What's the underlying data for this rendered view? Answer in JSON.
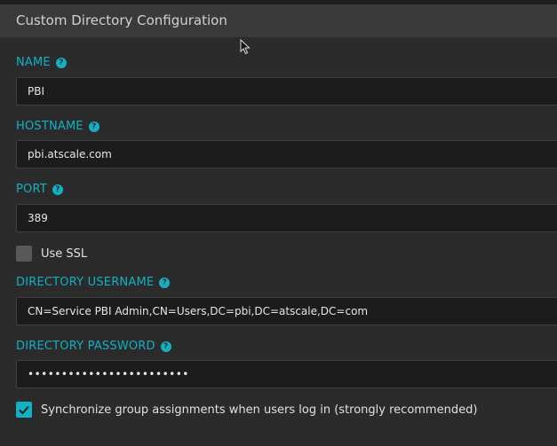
{
  "header": {
    "title": "Custom Directory Configuration"
  },
  "fields": {
    "name": {
      "label": "NAME",
      "value": "PBI"
    },
    "hostname": {
      "label": "HOSTNAME",
      "value": "pbi.atscale.com"
    },
    "port": {
      "label": "PORT",
      "value": "389"
    },
    "use_ssl": {
      "label": "Use SSL",
      "checked": false
    },
    "directory_username": {
      "label": "DIRECTORY USERNAME",
      "value": "CN=Service PBI Admin,CN=Users,DC=pbi,DC=atscale,DC=com"
    },
    "directory_password": {
      "label": "DIRECTORY PASSWORD",
      "value": "••••••••••••••••••••••••"
    },
    "sync_groups": {
      "label": "Synchronize group assignments when users log in (strongly recommended)",
      "checked": true
    }
  },
  "help_icon_glyph": "?",
  "colors": {
    "accent": "#12b0c4",
    "background": "#2b2b2b",
    "input_bg": "#1c1c1c"
  }
}
